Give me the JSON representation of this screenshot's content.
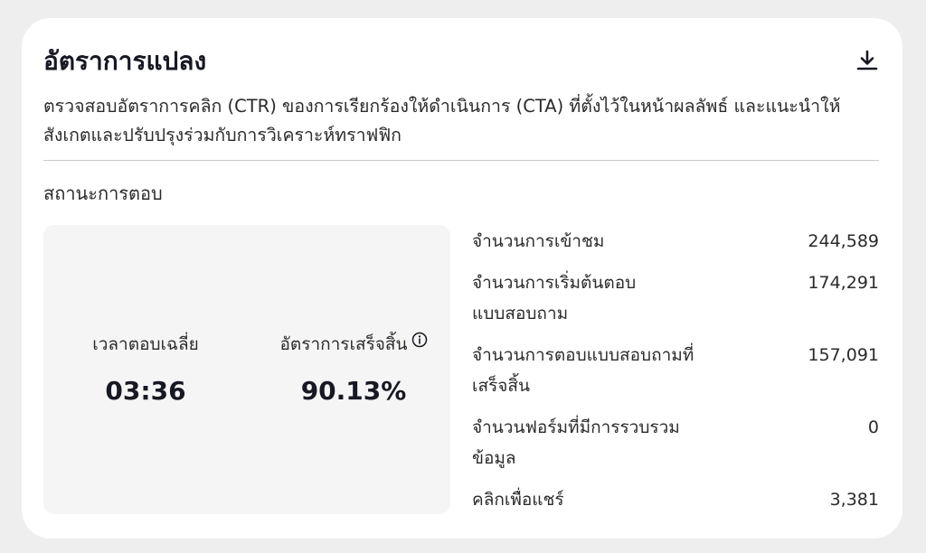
{
  "card": {
    "title": "อัตราการแปลง",
    "download_icon": "download-icon",
    "description": "ตรวจสอบอัตราการคลิก (CTR) ของการเรียกร้องให้ดำเนินการ (CTA) ที่ตั้งไว้ในหน้าผลลัพธ์ และแนะนำให้สังเกตและปรับปรุงร่วมกับการวิเคราะห์ทราฟฟิก",
    "section_title": "สถานะการตอบ"
  },
  "summary": {
    "avg_time_label": "เวลาตอบเฉลี่ย",
    "avg_time_value": "03:36",
    "completion_rate_label": "อัตราการเสร็จสิ้น",
    "completion_rate_value": "90.13%",
    "info_icon": "info-icon"
  },
  "stats": [
    {
      "label": "จำนวนการเข้าชม",
      "value": "244,589"
    },
    {
      "label": "จำนวนการเริ่มต้นตอบแบบสอบถาม",
      "value": "174,291"
    },
    {
      "label": "จำนวนการตอบแบบสอบถามที่เสร็จสิ้น",
      "value": "157,091"
    },
    {
      "label": "จำนวนฟอร์มที่มีการรวบรวมข้อมูล",
      "value": "0"
    },
    {
      "label": "คลิกเพื่อแชร์",
      "value": "3,381"
    }
  ]
}
